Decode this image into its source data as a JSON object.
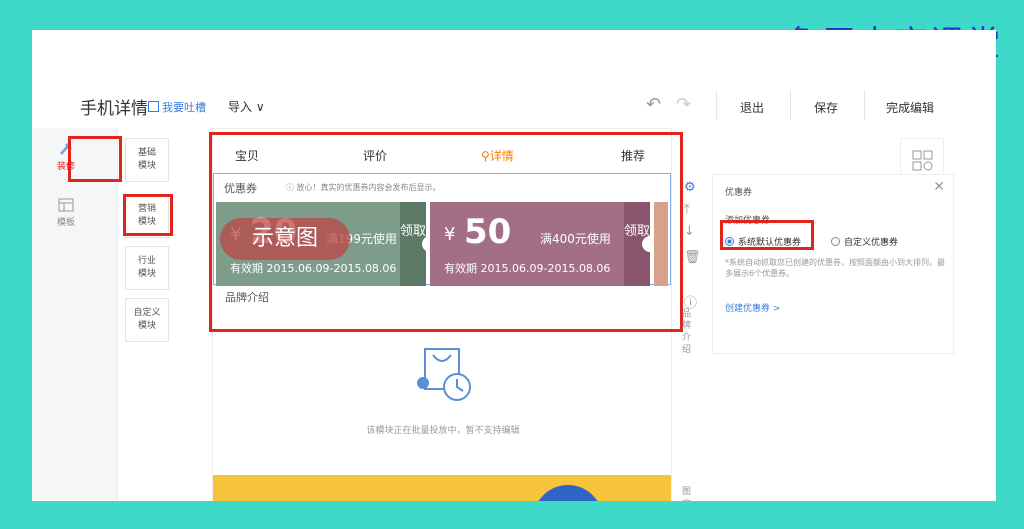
{
  "watermark": "象牙电商课堂",
  "header": {
    "title": "手机详情",
    "feedback_link": "我要吐槽",
    "import_label": "导入 ∨",
    "undo_icon": "undo-icon",
    "redo_icon": "redo-icon",
    "exit_label": "退出",
    "save_label": "保存",
    "finish_label": "完成编辑"
  },
  "rail": {
    "decorate_label": "装修",
    "template_label": "模板"
  },
  "categories": [
    "基础\n模块",
    "营销\n模块",
    "行业\n模块",
    "自定义\n模块"
  ],
  "tabs": [
    "宝贝",
    "评价",
    "详情",
    "推荐"
  ],
  "coupon_module": {
    "title": "优惠券",
    "note": "ⓘ 放心！真实的优惠券内容会发布后显示。",
    "coupons": [
      {
        "yen": "¥",
        "amount": "20",
        "condition": "满199元使用",
        "validity": "有效期 2015.06.09-2015.08.06",
        "claim": "领取"
      },
      {
        "yen": "¥",
        "amount": "50",
        "condition": "满400元使用",
        "validity": "有效期 2015.06.09-2015.08.06",
        "claim": "领取"
      }
    ],
    "overlay_label": "示意图"
  },
  "brand_module": {
    "title": "品牌介绍",
    "loading_text": "该模块正在批量投放中，暂不支持编辑"
  },
  "tools": {
    "brand_label": "品牌介绍",
    "graphic_label": "图文"
  },
  "panel": {
    "title": "优惠券",
    "subtitle": "添加优惠券",
    "option_default": "系统默认优惠券",
    "option_custom": "自定义优惠券",
    "hint": "*系统自动抓取您已创建的优惠券，按照面额由小到大排列，最多展示6个优惠券。",
    "create_link": "创建优惠券 >"
  },
  "colors": {
    "accent_red": "#e1251b",
    "link_blue": "#3a7de0",
    "tab_active": "#ff7a00",
    "background": "#3fd9c9"
  }
}
